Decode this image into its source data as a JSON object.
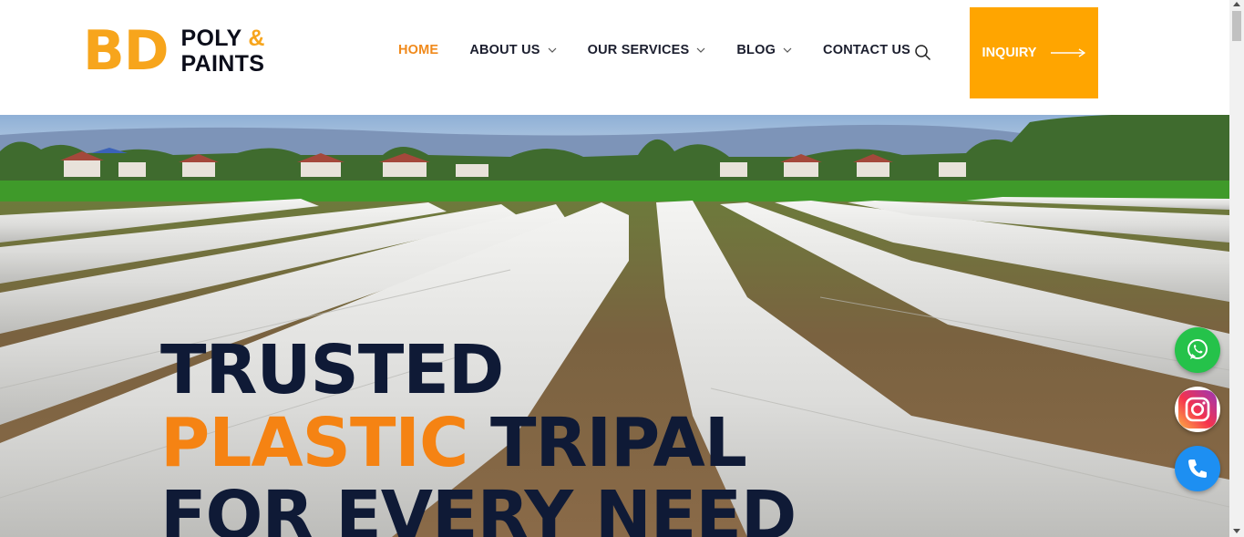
{
  "header": {
    "logo": {
      "mark": "BD",
      "line1": "POLY",
      "amp": "&",
      "line2": "PAINTS"
    },
    "nav": [
      {
        "label": "HOME",
        "active": true,
        "dropdown": false
      },
      {
        "label": "ABOUT US",
        "active": false,
        "dropdown": true
      },
      {
        "label": "OUR SERVICES",
        "active": false,
        "dropdown": true
      },
      {
        "label": "BLOG",
        "active": false,
        "dropdown": true
      },
      {
        "label": "CONTACT US",
        "active": false,
        "dropdown": false
      }
    ],
    "search_icon": "search-icon",
    "inquiry_label": "INQUIRY",
    "inquiry_icon": "arrow-right-icon"
  },
  "hero": {
    "line1": "TRUSTED",
    "line2_highlight": "PLASTIC",
    "line2_rest": " TRIPAL",
    "line3": "FOR EVERY NEED"
  },
  "floating": [
    {
      "name": "whatsapp",
      "icon": "whatsapp-icon",
      "color": "#25c24a"
    },
    {
      "name": "instagram",
      "icon": "instagram-icon",
      "color": "#e1306c"
    },
    {
      "name": "phone",
      "icon": "phone-icon",
      "color": "#1d8ff2"
    }
  ],
  "colors": {
    "accent": "#ffa500",
    "logo_orange": "#f7a51c",
    "nav_active": "#f08a1c",
    "headline_dark": "#0f1a36",
    "headline_orange": "#f58313"
  }
}
